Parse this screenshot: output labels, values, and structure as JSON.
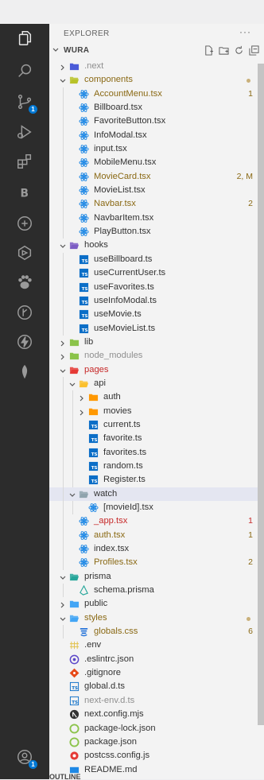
{
  "explorer": {
    "title": "EXPLORER",
    "more": "···",
    "workspace": "WURA",
    "outline": "OUTLINE"
  },
  "activity_bar": {
    "icons": [
      "files-icon",
      "search-icon",
      "source-control-icon",
      "run-debug-icon",
      "extensions-icon",
      "letter-b-icon",
      "remote-icon",
      "docker-icon",
      "paw-icon",
      "git-graph-icon",
      "lightning-icon",
      "leaf-icon",
      "accounts-icon"
    ],
    "source_control_badge": "1",
    "accounts_badge": "1"
  },
  "tree": [
    {
      "label": ".next",
      "depth": 1,
      "kind": "folder",
      "open": false,
      "dim": true,
      "icon": "folder-next-icon"
    },
    {
      "label": "components",
      "depth": 1,
      "kind": "folder",
      "open": true,
      "status": "mod",
      "dot": true,
      "icon": "folder-components-icon"
    },
    {
      "label": "AccountMenu.tsx",
      "depth": 2,
      "kind": "file",
      "status": "mod",
      "badge": "1",
      "icon": "react-icon"
    },
    {
      "label": "Billboard.tsx",
      "depth": 2,
      "kind": "file",
      "icon": "react-icon"
    },
    {
      "label": "FavoriteButton.tsx",
      "depth": 2,
      "kind": "file",
      "icon": "react-icon"
    },
    {
      "label": "InfoModal.tsx",
      "depth": 2,
      "kind": "file",
      "icon": "react-icon"
    },
    {
      "label": "input.tsx",
      "depth": 2,
      "kind": "file",
      "icon": "react-icon"
    },
    {
      "label": "MobileMenu.tsx",
      "depth": 2,
      "kind": "file",
      "icon": "react-icon"
    },
    {
      "label": "MovieCard.tsx",
      "depth": 2,
      "kind": "file",
      "status": "mod",
      "badge": "2, M",
      "icon": "react-icon"
    },
    {
      "label": "MovieList.tsx",
      "depth": 2,
      "kind": "file",
      "icon": "react-icon"
    },
    {
      "label": "Navbar.tsx",
      "depth": 2,
      "kind": "file",
      "status": "mod",
      "badge": "2",
      "icon": "react-icon"
    },
    {
      "label": "NavbarItem.tsx",
      "depth": 2,
      "kind": "file",
      "icon": "react-icon"
    },
    {
      "label": "PlayButton.tsx",
      "depth": 2,
      "kind": "file",
      "icon": "react-icon"
    },
    {
      "label": "hooks",
      "depth": 1,
      "kind": "folder",
      "open": true,
      "icon": "folder-hooks-icon"
    },
    {
      "label": "useBillboard.ts",
      "depth": 2,
      "kind": "file",
      "icon": "typescript-icon"
    },
    {
      "label": "useCurrentUser.ts",
      "depth": 2,
      "kind": "file",
      "icon": "typescript-icon"
    },
    {
      "label": "useFavorites.ts",
      "depth": 2,
      "kind": "file",
      "icon": "typescript-icon"
    },
    {
      "label": "useInfoModal.ts",
      "depth": 2,
      "kind": "file",
      "icon": "typescript-icon"
    },
    {
      "label": "useMovie.ts",
      "depth": 2,
      "kind": "file",
      "icon": "typescript-icon"
    },
    {
      "label": "useMovieList.ts",
      "depth": 2,
      "kind": "file",
      "icon": "typescript-icon"
    },
    {
      "label": "lib",
      "depth": 1,
      "kind": "folder",
      "open": false,
      "icon": "folder-lib-icon"
    },
    {
      "label": "node_modules",
      "depth": 1,
      "kind": "folder",
      "open": false,
      "dim": true,
      "icon": "folder-node-icon"
    },
    {
      "label": "pages",
      "depth": 1,
      "kind": "folder",
      "open": true,
      "status": "err",
      "icon": "folder-pages-icon"
    },
    {
      "label": "api",
      "depth": 2,
      "kind": "folder",
      "open": true,
      "icon": "folder-api-icon"
    },
    {
      "label": "auth",
      "depth": 3,
      "kind": "folder",
      "open": false,
      "icon": "folder-auth-icon"
    },
    {
      "label": "movies",
      "depth": 3,
      "kind": "folder",
      "open": false,
      "icon": "folder-movies-icon"
    },
    {
      "label": "current.ts",
      "depth": 3,
      "kind": "file",
      "icon": "typescript-icon"
    },
    {
      "label": "favorite.ts",
      "depth": 3,
      "kind": "file",
      "icon": "typescript-icon"
    },
    {
      "label": "favorites.ts",
      "depth": 3,
      "kind": "file",
      "icon": "typescript-icon"
    },
    {
      "label": "random.ts",
      "depth": 3,
      "kind": "file",
      "icon": "typescript-icon"
    },
    {
      "label": "Register.ts",
      "depth": 3,
      "kind": "file",
      "icon": "typescript-icon"
    },
    {
      "label": "watch",
      "depth": 2,
      "kind": "folder",
      "open": true,
      "selected": true,
      "icon": "folder-watch-icon"
    },
    {
      "label": "[movieId].tsx",
      "depth": 3,
      "kind": "file",
      "icon": "react-icon"
    },
    {
      "label": "_app.tsx",
      "depth": 2,
      "kind": "file",
      "status": "err",
      "badge": "1",
      "icon": "react-icon"
    },
    {
      "label": "auth.tsx",
      "depth": 2,
      "kind": "file",
      "status": "mod",
      "badge": "1",
      "icon": "react-icon"
    },
    {
      "label": "index.tsx",
      "depth": 2,
      "kind": "file",
      "icon": "react-icon"
    },
    {
      "label": "Profiles.tsx",
      "depth": 2,
      "kind": "file",
      "status": "mod",
      "badge": "2",
      "icon": "react-icon"
    },
    {
      "label": "prisma",
      "depth": 1,
      "kind": "folder",
      "open": true,
      "icon": "folder-prisma-icon"
    },
    {
      "label": "schema.prisma",
      "depth": 2,
      "kind": "file",
      "icon": "prisma-icon"
    },
    {
      "label": "public",
      "depth": 1,
      "kind": "folder",
      "open": false,
      "icon": "folder-public-icon"
    },
    {
      "label": "styles",
      "depth": 1,
      "kind": "folder",
      "open": true,
      "status": "mod",
      "dot": true,
      "icon": "folder-styles-icon"
    },
    {
      "label": "globals.css",
      "depth": 2,
      "kind": "file",
      "status": "mod",
      "badge": "6",
      "icon": "css-icon"
    },
    {
      "label": ".env",
      "depth": 1,
      "kind": "file",
      "icon": "env-icon"
    },
    {
      "label": ".eslintrc.json",
      "depth": 1,
      "kind": "file",
      "icon": "eslint-icon"
    },
    {
      "label": ".gitignore",
      "depth": 1,
      "kind": "file",
      "icon": "git-icon"
    },
    {
      "label": "global.d.ts",
      "depth": 1,
      "kind": "file",
      "icon": "typescript-def-icon"
    },
    {
      "label": "next-env.d.ts",
      "depth": 1,
      "kind": "file",
      "dim": true,
      "icon": "typescript-def-icon"
    },
    {
      "label": "next.config.mjs",
      "depth": 1,
      "kind": "file",
      "icon": "next-icon"
    },
    {
      "label": "package-lock.json",
      "depth": 1,
      "kind": "file",
      "icon": "npm-icon"
    },
    {
      "label": "package.json",
      "depth": 1,
      "kind": "file",
      "icon": "npm-icon"
    },
    {
      "label": "postcss.config.js",
      "depth": 1,
      "kind": "file",
      "icon": "postcss-icon"
    },
    {
      "label": "README.md",
      "depth": 1,
      "kind": "file",
      "icon": "readme-icon"
    }
  ],
  "colors": {
    "activity_bg": "#2c2c2c",
    "sidebar_bg": "#f3f3f3",
    "modified": "#8a6914",
    "error": "#c62828",
    "selected_row": "#e4e6f1",
    "react": "#1e88e5",
    "typescript": "#0b6ec7"
  }
}
